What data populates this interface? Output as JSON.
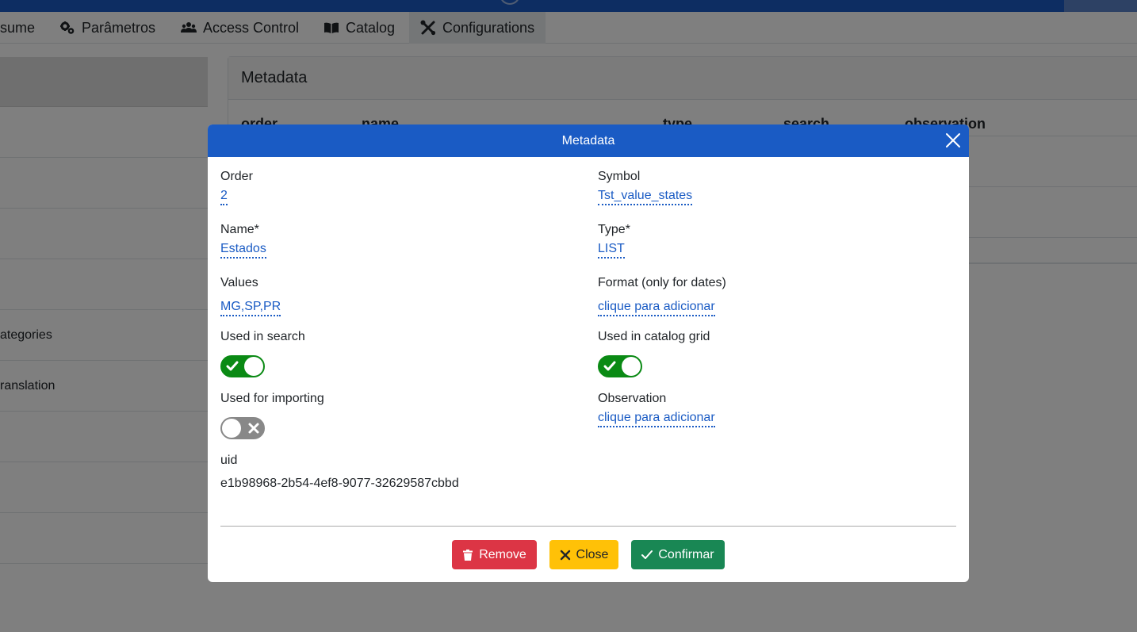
{
  "nav": {
    "items": [
      {
        "label": "sume",
        "icon": "none"
      },
      {
        "label": "Parâmetros",
        "icon": "cogs-icon"
      },
      {
        "label": "Access Control",
        "icon": "users-icon"
      },
      {
        "label": "Catalog",
        "icon": "book-icon"
      },
      {
        "label": "Configurations",
        "icon": "tools-icon"
      }
    ]
  },
  "sidebar": {
    "items": [
      "",
      "",
      "",
      "",
      "ategories",
      "ranslation",
      "",
      "",
      ""
    ]
  },
  "panel": {
    "title": "Metadata",
    "columns": [
      "order",
      "name",
      "type",
      "search",
      "observation"
    ]
  },
  "modal": {
    "title": "Metadata",
    "fields": {
      "order": {
        "label": "Order",
        "value": "2"
      },
      "symbol": {
        "label": "Symbol",
        "value": "Tst_value_states"
      },
      "name": {
        "label": "Name*",
        "value": "Estados"
      },
      "type": {
        "label": "Type*",
        "value": "LIST"
      },
      "values": {
        "label": "Values",
        "value": "MG,SP,PR"
      },
      "format": {
        "label": "Format (only for dates)",
        "value": "clique para adicionar"
      },
      "used_in_search": {
        "label": "Used in search",
        "checked": true
      },
      "used_in_catalog_grid": {
        "label": "Used in catalog grid",
        "checked": true
      },
      "used_for_importing": {
        "label": "Used for importing",
        "checked": false
      },
      "observation": {
        "label": "Observation",
        "value": "clique para adicionar"
      },
      "uid": {
        "label": "uid",
        "value": "e1b98968-2b54-4ef8-9077-32629587cbbd"
      }
    },
    "buttons": {
      "remove": "Remove",
      "close": "Close",
      "confirm": "Confirmar"
    }
  },
  "colors": {
    "primary": "#1a5bc4",
    "danger": "#dc3545",
    "warning": "#ffc107",
    "success": "#198754",
    "toggle_on": "#0a8a14",
    "toggle_off": "#888888"
  }
}
